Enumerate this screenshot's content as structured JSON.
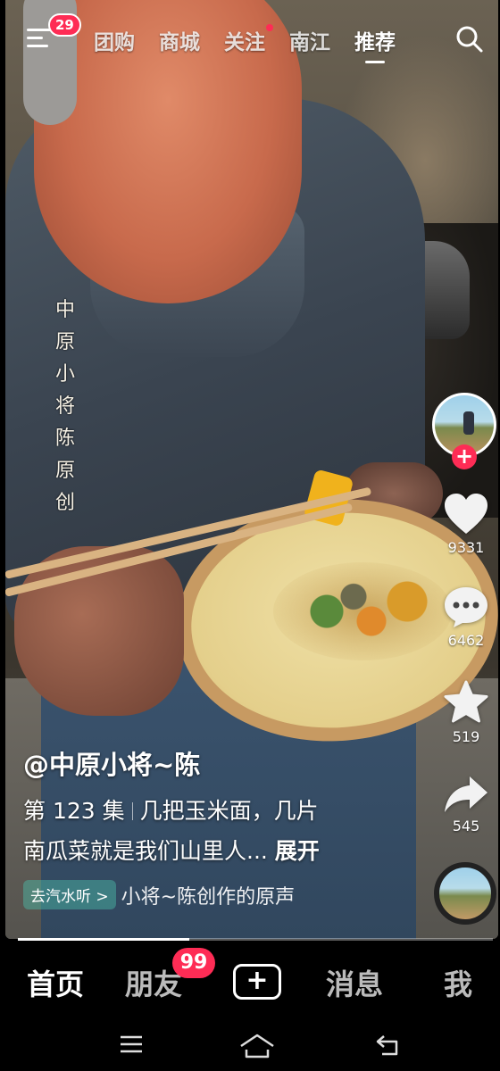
{
  "top_bar": {
    "menu_badge": "29",
    "tabs": [
      {
        "label": "团购",
        "active": false,
        "dot": false
      },
      {
        "label": "商城",
        "active": false,
        "dot": false
      },
      {
        "label": "关注",
        "active": false,
        "dot": true
      },
      {
        "label": "南江",
        "active": false,
        "dot": false
      },
      {
        "label": "推荐",
        "active": true,
        "dot": false
      }
    ],
    "search_icon": "search-icon"
  },
  "video": {
    "watermark": [
      "中",
      "原",
      "小",
      "将",
      "陈",
      "原",
      "创"
    ],
    "playback_progress": 0.36
  },
  "side_rail": {
    "likes": "9331",
    "comments": "6462",
    "favorites": "519",
    "shares": "545"
  },
  "caption": {
    "author": "@中原小将~陈",
    "episode": "第 123 集",
    "desc_part1": "几把玉米面，几片",
    "desc_part2": "南瓜菜就是我们山里人...",
    "expand": "展开",
    "music_chip": "去汽水听 >",
    "music_title": "小将~陈创作的原声"
  },
  "bottom_nav": {
    "home": "首页",
    "friends": "朋友",
    "friends_badge": "99",
    "create": "+",
    "messages": "消息",
    "me": "我"
  },
  "colors": {
    "accent": "#fe2c55",
    "nav_bg": "#000000"
  }
}
